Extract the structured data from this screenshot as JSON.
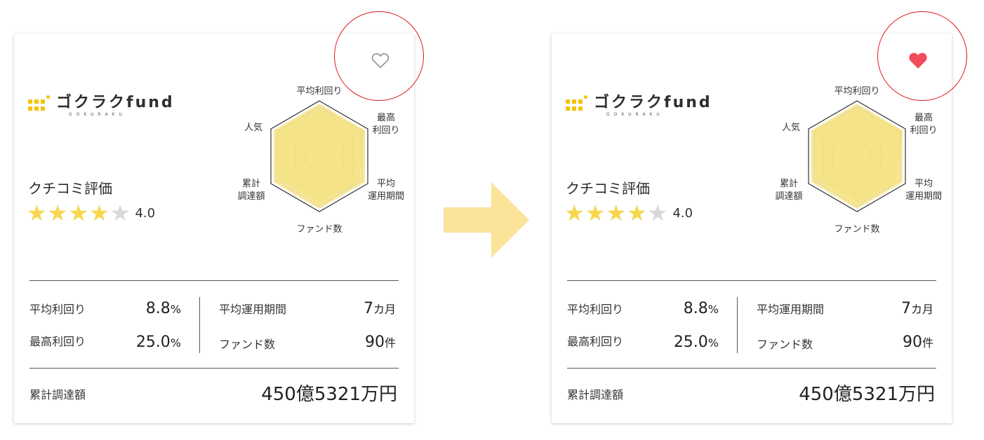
{
  "cards": [
    {
      "favorite_state": "unfilled",
      "logo_text": "ゴクラクfund",
      "logo_sub": "GOKURAKU",
      "review_label": "クチコミ評価",
      "rating": "4.0",
      "stars_filled": 4,
      "stars_total": 5,
      "radar_labels": {
        "top": "平均利回り",
        "upper_right_1": "最高",
        "upper_right_2": "利回り",
        "lower_right_1": "平均",
        "lower_right_2": "運用期間",
        "bottom": "ファンド数",
        "lower_left_1": "累計",
        "lower_left_2": "調達額",
        "upper_left": "人気"
      },
      "stats": {
        "avg_yield_label": "平均利回り",
        "avg_yield_value": "8.8",
        "avg_yield_unit": "%",
        "max_yield_label": "最高利回り",
        "max_yield_value": "25.0",
        "max_yield_unit": "%",
        "avg_period_label": "平均運用期間",
        "avg_period_value": "7",
        "avg_period_unit": "カ月",
        "fund_count_label": "ファンド数",
        "fund_count_value": "90",
        "fund_count_unit": "件"
      },
      "total_label": "累計調達額",
      "total_value": "450億5321万円"
    },
    {
      "favorite_state": "filled",
      "logo_text": "ゴクラクfund",
      "logo_sub": "GOKURAKU",
      "review_label": "クチコミ評価",
      "rating": "4.0",
      "stars_filled": 4,
      "stars_total": 5,
      "radar_labels": {
        "top": "平均利回り",
        "upper_right_1": "最高",
        "upper_right_2": "利回り",
        "lower_right_1": "平均",
        "lower_right_2": "運用期間",
        "bottom": "ファンド数",
        "lower_left_1": "累計",
        "lower_left_2": "調達額",
        "upper_left": "人気"
      },
      "stats": {
        "avg_yield_label": "平均利回り",
        "avg_yield_value": "8.8",
        "avg_yield_unit": "%",
        "max_yield_label": "最高利回り",
        "max_yield_value": "25.0",
        "max_yield_unit": "%",
        "avg_period_label": "平均運用期間",
        "avg_period_value": "7",
        "avg_period_unit": "カ月",
        "fund_count_label": "ファンド数",
        "fund_count_value": "90",
        "fund_count_unit": "件"
      },
      "total_label": "累計調達額",
      "total_value": "450億5321万円"
    }
  ],
  "colors": {
    "accent_yellow": "#f7d64d",
    "radar_fill": "#f8e89a",
    "heart_filled": "#f24b5a",
    "highlight_circle": "#e0141e",
    "arrow": "#fbe49a"
  },
  "icons": [
    "heart-outline-icon",
    "heart-filled-icon",
    "star-icon",
    "arrow-right-icon"
  ]
}
